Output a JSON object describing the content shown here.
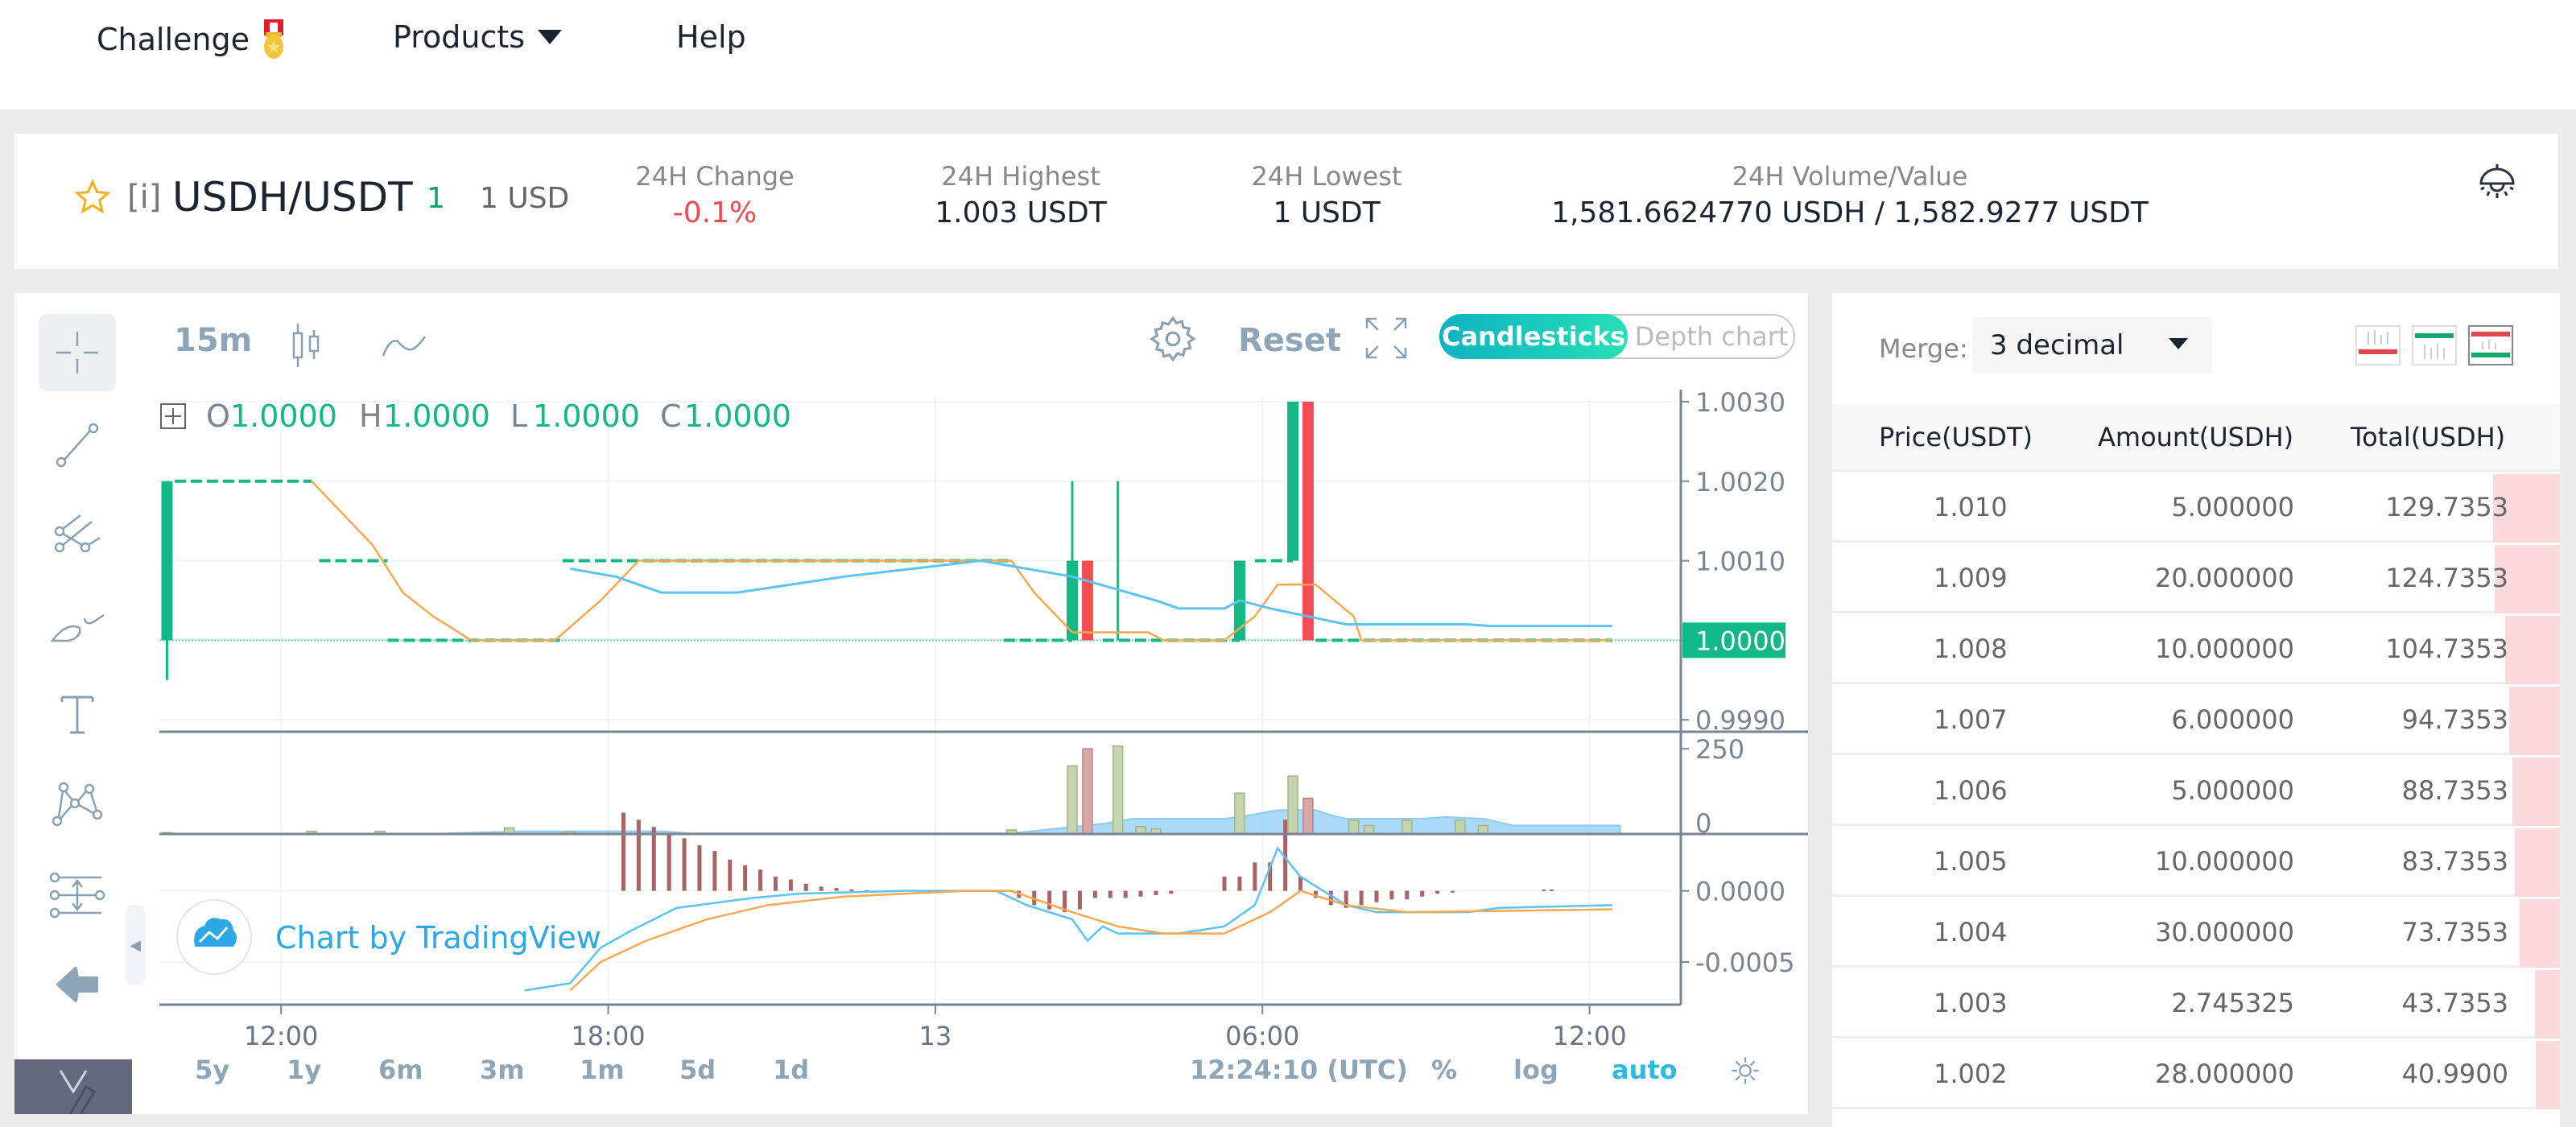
{
  "nav": {
    "items": [
      {
        "label": "Challenge",
        "icon": "medal-icon"
      },
      {
        "label": "Products",
        "icon": "caret-down-icon"
      },
      {
        "label": "Help"
      }
    ]
  },
  "ticker": {
    "info_label": "[i]",
    "pair": "USDH/USDT",
    "last_price": "1",
    "usd_value": "1 USD",
    "stats": [
      {
        "label": "24H Change",
        "value": "-0.1%",
        "negative": true
      },
      {
        "label": "24H Highest",
        "value": "1.003 USDT"
      },
      {
        "label": "24H Lowest",
        "value": "1 USDT"
      },
      {
        "label": "24H Volume/Value",
        "value": "1,581.6624770 USDH / 1,582.9277 USDT"
      }
    ]
  },
  "chart_toolbar": {
    "interval": "15m",
    "reset_label": "Reset",
    "view_toggle": {
      "active": "Candlesticks",
      "inactive": "Depth chart"
    }
  },
  "legend": {
    "o_label": "O",
    "o": "1.0000",
    "h_label": "H",
    "h": "1.0000",
    "l_label": "L",
    "l": "1.0000",
    "c_label": "C",
    "c": "1.0000"
  },
  "watermark": "Chart by TradingView",
  "bottom_bar": {
    "ranges": [
      "5y",
      "1y",
      "6m",
      "3m",
      "1m",
      "5d",
      "1d"
    ],
    "clock": "12:24:10 (UTC)",
    "percent": "%",
    "log": "log",
    "auto": "auto"
  },
  "colors": {
    "up": "#12b886",
    "down": "#f44e53",
    "accent": "#1fc8c0",
    "ma_orange": "#f7a850",
    "ma_blue": "#5bc4ef"
  },
  "chart_data": {
    "type": "candlestick",
    "price_axis": {
      "ticks": [
        "1.0030",
        "1.0020",
        "1.0010",
        "1.0000",
        "0.9990"
      ],
      "range": [
        0.99885,
        1.00305
      ],
      "last_price_label": "1.0000"
    },
    "volume_axis": {
      "ticks": [
        "250",
        "0"
      ],
      "range": [
        0,
        300
      ]
    },
    "macd_axis": {
      "ticks": [
        "0.0000",
        "-0.0005"
      ],
      "range": [
        -0.0008,
        0.0004
      ]
    },
    "time_ticks": [
      "12:00",
      "18:00",
      "13",
      "06:00",
      "12:00"
    ],
    "time_tick_positions": [
      0.08,
      0.295,
      0.51,
      0.725,
      0.94
    ],
    "candles": [
      {
        "t": 0.005,
        "o": 1.0,
        "h": 1.002,
        "l": 0.9995,
        "c": 1.002,
        "kind": "body"
      },
      {
        "t": 0.6,
        "o": 1.0,
        "h": 1.002,
        "l": 1.0,
        "c": 1.001,
        "kind": "body"
      },
      {
        "t": 0.61,
        "o": 1.001,
        "h": 1.001,
        "l": 1.0,
        "c": 1.0,
        "kind": "body"
      },
      {
        "t": 0.63,
        "o": 1.0,
        "h": 1.002,
        "l": 1.0,
        "c": 1.0,
        "kind": "wick"
      },
      {
        "t": 0.71,
        "o": 1.0,
        "h": 1.001,
        "l": 1.0,
        "c": 1.001,
        "kind": "body"
      },
      {
        "t": 0.745,
        "o": 1.001,
        "h": 1.003,
        "l": 1.001,
        "c": 1.003,
        "kind": "body"
      },
      {
        "t": 0.755,
        "o": 1.003,
        "h": 1.003,
        "l": 1.0,
        "c": 1.0,
        "kind": "body"
      }
    ],
    "flat_segments": [
      {
        "x0": 0.01,
        "x1": 0.1,
        "price": 1.002
      },
      {
        "x0": 0.105,
        "x1": 0.15,
        "price": 1.001
      },
      {
        "x0": 0.15,
        "x1": 0.265,
        "price": 1.0
      },
      {
        "x0": 0.265,
        "x1": 0.56,
        "price": 1.001
      },
      {
        "x0": 0.555,
        "x1": 0.6,
        "price": 1.0
      },
      {
        "x0": 0.62,
        "x1": 0.71,
        "price": 1.0
      },
      {
        "x0": 0.72,
        "x1": 0.745,
        "price": 1.001
      },
      {
        "x0": 0.76,
        "x1": 0.955,
        "price": 1.0
      }
    ],
    "ma_orange": [
      [
        0.1,
        1.002
      ],
      [
        0.125,
        1.0015
      ],
      [
        0.14,
        1.0012
      ],
      [
        0.16,
        1.0006
      ],
      [
        0.18,
        1.0003
      ],
      [
        0.205,
        1.0
      ],
      [
        0.26,
        1.0
      ],
      [
        0.29,
        1.0005
      ],
      [
        0.315,
        1.001
      ],
      [
        0.56,
        1.001
      ],
      [
        0.575,
        1.0006
      ],
      [
        0.6,
        1.0001
      ],
      [
        0.65,
        1.0001
      ],
      [
        0.66,
        1.0
      ],
      [
        0.7,
        1.0
      ],
      [
        0.72,
        1.0003
      ],
      [
        0.735,
        1.0007
      ],
      [
        0.76,
        1.0007
      ],
      [
        0.785,
        1.0003
      ],
      [
        0.79,
        1.0
      ],
      [
        0.955,
        1.0
      ]
    ],
    "ma_blue": [
      [
        0.27,
        1.0009
      ],
      [
        0.3,
        1.0008
      ],
      [
        0.33,
        1.0006
      ],
      [
        0.38,
        1.0006
      ],
      [
        0.45,
        1.0008
      ],
      [
        0.54,
        1.001
      ],
      [
        0.57,
        1.0009
      ],
      [
        0.6,
        1.0008
      ],
      [
        0.655,
        1.0005
      ],
      [
        0.67,
        1.0004
      ],
      [
        0.7,
        1.0004
      ],
      [
        0.71,
        1.0005
      ],
      [
        0.73,
        1.0004
      ],
      [
        0.78,
        1.0002
      ],
      [
        0.86,
        1.0002
      ],
      [
        0.875,
        1.00018
      ],
      [
        0.955,
        1.00018
      ]
    ],
    "volume_bars": [
      {
        "t": 0.005,
        "v": 4,
        "up": true
      },
      {
        "t": 0.1,
        "v": 8,
        "up": true
      },
      {
        "t": 0.145,
        "v": 8,
        "up": true
      },
      {
        "t": 0.23,
        "v": 18,
        "up": true
      },
      {
        "t": 0.27,
        "v": 7,
        "up": true
      },
      {
        "t": 0.56,
        "v": 12,
        "up": true
      },
      {
        "t": 0.6,
        "v": 200,
        "up": true
      },
      {
        "t": 0.61,
        "v": 250,
        "up": false
      },
      {
        "t": 0.63,
        "v": 258,
        "up": true
      },
      {
        "t": 0.645,
        "v": 22,
        "up": true
      },
      {
        "t": 0.655,
        "v": 15,
        "up": true
      },
      {
        "t": 0.71,
        "v": 120,
        "up": true
      },
      {
        "t": 0.745,
        "v": 170,
        "up": true
      },
      {
        "t": 0.755,
        "v": 105,
        "up": false
      },
      {
        "t": 0.785,
        "v": 40,
        "up": true
      },
      {
        "t": 0.795,
        "v": 25,
        "up": true
      },
      {
        "t": 0.82,
        "v": 40,
        "up": true
      },
      {
        "t": 0.855,
        "v": 40,
        "up": true
      },
      {
        "t": 0.87,
        "v": 25,
        "up": true
      }
    ],
    "volume_ma": [
      [
        0.19,
        2
      ],
      [
        0.24,
        8
      ],
      [
        0.33,
        8
      ],
      [
        0.35,
        2
      ],
      [
        0.56,
        2
      ],
      [
        0.62,
        30
      ],
      [
        0.64,
        45
      ],
      [
        0.7,
        45
      ],
      [
        0.71,
        50
      ],
      [
        0.735,
        70
      ],
      [
        0.76,
        70
      ],
      [
        0.77,
        55
      ],
      [
        0.78,
        45
      ],
      [
        0.83,
        45
      ],
      [
        0.845,
        50
      ],
      [
        0.87,
        45
      ],
      [
        0.89,
        25
      ],
      [
        0.96,
        25
      ]
    ],
    "macd_hist": [
      [
        0.305,
        0.00055
      ],
      [
        0.315,
        0.0005
      ],
      [
        0.325,
        0.00045
      ],
      [
        0.335,
        0.0004
      ],
      [
        0.345,
        0.00037
      ],
      [
        0.355,
        0.00032
      ],
      [
        0.365,
        0.00028
      ],
      [
        0.375,
        0.00022
      ],
      [
        0.385,
        0.00018
      ],
      [
        0.395,
        0.00015
      ],
      [
        0.405,
        0.0001
      ],
      [
        0.415,
        8e-05
      ],
      [
        0.425,
        5e-05
      ],
      [
        0.435,
        3e-05
      ],
      [
        0.445,
        2e-05
      ],
      [
        0.455,
        1e-05
      ],
      [
        0.465,
        5e-06
      ],
      [
        0.565,
        -5e-05
      ],
      [
        0.575,
        -0.0001
      ],
      [
        0.585,
        -0.00013
      ],
      [
        0.595,
        -0.00015
      ],
      [
        0.605,
        -0.00013
      ],
      [
        0.615,
        -5e-05
      ],
      [
        0.625,
        -5e-05
      ],
      [
        0.635,
        -5e-05
      ],
      [
        0.645,
        -4e-05
      ],
      [
        0.655,
        -3e-05
      ],
      [
        0.665,
        -2e-05
      ],
      [
        0.7,
        0.0001
      ],
      [
        0.71,
        0.0001
      ],
      [
        0.72,
        0.0002
      ],
      [
        0.73,
        0.0002
      ],
      [
        0.74,
        0.0005
      ],
      [
        0.75,
        0.0001
      ],
      [
        0.76,
        -5e-05
      ],
      [
        0.77,
        -0.0001
      ],
      [
        0.78,
        -0.00012
      ],
      [
        0.79,
        -0.0001
      ],
      [
        0.8,
        -8e-05
      ],
      [
        0.81,
        -6e-05
      ],
      [
        0.82,
        -6e-05
      ],
      [
        0.83,
        -4e-05
      ],
      [
        0.84,
        -2e-05
      ],
      [
        0.85,
        -1e-05
      ],
      [
        0.91,
        1e-05
      ],
      [
        0.915,
        1e-05
      ]
    ],
    "macd_line": [
      [
        0.24,
        -0.0007
      ],
      [
        0.27,
        -0.00065
      ],
      [
        0.29,
        -0.0004
      ],
      [
        0.31,
        -0.00028
      ],
      [
        0.34,
        -0.00012
      ],
      [
        0.39,
        -5e-05
      ],
      [
        0.42,
        -2e-05
      ],
      [
        0.49,
        0.0
      ],
      [
        0.55,
        0.0
      ],
      [
        0.57,
        -0.0001
      ],
      [
        0.6,
        -0.0002
      ],
      [
        0.61,
        -0.00035
      ],
      [
        0.62,
        -0.00025
      ],
      [
        0.63,
        -0.0003
      ],
      [
        0.67,
        -0.0003
      ],
      [
        0.7,
        -0.00025
      ],
      [
        0.72,
        -0.0001
      ],
      [
        0.735,
        0.0003
      ],
      [
        0.75,
        0.0001
      ],
      [
        0.78,
        -0.0001
      ],
      [
        0.8,
        -0.00015
      ],
      [
        0.86,
        -0.00015
      ],
      [
        0.88,
        -0.00012
      ],
      [
        0.955,
        -0.0001
      ]
    ],
    "signal_line": [
      [
        0.27,
        -0.0007
      ],
      [
        0.29,
        -0.0005
      ],
      [
        0.32,
        -0.00035
      ],
      [
        0.36,
        -0.0002
      ],
      [
        0.4,
        -0.0001
      ],
      [
        0.45,
        -4e-05
      ],
      [
        0.53,
        0.0
      ],
      [
        0.56,
        0.0
      ],
      [
        0.6,
        -0.00015
      ],
      [
        0.63,
        -0.00025
      ],
      [
        0.66,
        -0.0003
      ],
      [
        0.7,
        -0.0003
      ],
      [
        0.73,
        -0.00015
      ],
      [
        0.75,
        0.0
      ],
      [
        0.78,
        -0.0001
      ],
      [
        0.82,
        -0.00015
      ],
      [
        0.955,
        -0.00013
      ]
    ]
  },
  "orderbook": {
    "merge_label": "Merge:",
    "merge_value": "3 decimal",
    "headers": [
      "Price(USDT)",
      "Amount(USDH)",
      "Total(USDH)"
    ],
    "max_total": 129.7353,
    "rows": [
      {
        "price": "1.010",
        "amount": "5.000000",
        "total": "129.7353",
        "depth": 0.92
      },
      {
        "price": "1.009",
        "amount": "20.000000",
        "total": "124.7353",
        "depth": 0.9
      },
      {
        "price": "1.008",
        "amount": "10.000000",
        "total": "104.7353",
        "depth": 0.76
      },
      {
        "price": "1.007",
        "amount": "6.000000",
        "total": "94.7353",
        "depth": 0.7
      },
      {
        "price": "1.006",
        "amount": "5.000000",
        "total": "88.7353",
        "depth": 0.65
      },
      {
        "price": "1.005",
        "amount": "10.000000",
        "total": "83.7353",
        "depth": 0.62
      },
      {
        "price": "1.004",
        "amount": "30.000000",
        "total": "73.7353",
        "depth": 0.55
      },
      {
        "price": "1.003",
        "amount": "2.745325",
        "total": "43.7353",
        "depth": 0.34
      },
      {
        "price": "1.002",
        "amount": "28.000000",
        "total": "40.9900",
        "depth": 0.33
      }
    ]
  }
}
